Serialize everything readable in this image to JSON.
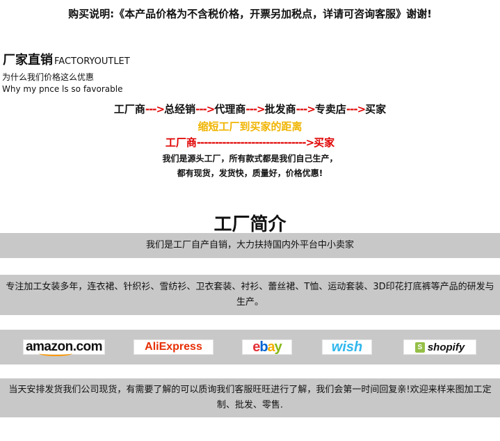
{
  "notice": "购买说明:《本产品价格为不含税价格，开票另加税点，详请可咨询客服》谢谢!",
  "brand": {
    "title_cn": "厂家直销",
    "title_en": "FACTORYOUTLET"
  },
  "why": {
    "cn": "为什么我们价格这么优惠",
    "en": "Why my pnce ls so favorable"
  },
  "chain": {
    "steps": [
      "工厂商",
      "总经销",
      "代理商",
      "批发商",
      "专卖店",
      "买家"
    ],
    "arrow": "--->"
  },
  "slogan": "缩短工厂到买家的距离",
  "direct": {
    "from": "工厂商",
    "arrow": "------------------------------>",
    "to": "买家"
  },
  "desc": {
    "line1": "我们是源头工厂，所有款式都是我们自己生产，",
    "line2": "都有现货，发货快，质量好，价格优惠!"
  },
  "intro": {
    "title": "工厂简介",
    "band1": "我们是工厂自产自销，大力扶持国内外平台中小卖家",
    "band2": "专注加工女装多年，连衣裙、针织衫、雪纺衫、卫衣套装、衬衫、蕾丝裙、T恤、运动套装、3D印花打底裤等产品的研发与生产。",
    "band4": "当天安排发货我们公司现货，有需要了解的可以质询我们客服旺旺进行了解，我们会第一时间回复亲!欢迎来样来图加工定制、批发、零售."
  },
  "platforms": {
    "amazon": "amazon.com",
    "aliexpress": "AliExpress",
    "ebay": [
      "e",
      "b",
      "a",
      "y"
    ],
    "wish": "wish",
    "shopify": "shopify",
    "icons": [
      "amazon-logo",
      "aliexpress-logo",
      "ebay-logo",
      "wish-logo",
      "shopify-logo"
    ]
  },
  "colors": {
    "arrow_red": "#e00000",
    "slogan_yellow": "#f0b400",
    "band_gray": "#c8c8c8"
  }
}
